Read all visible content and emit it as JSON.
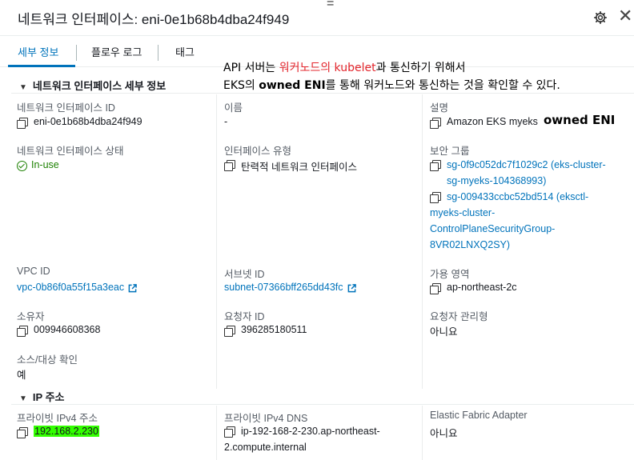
{
  "header": {
    "title": "네트워크 인터페이스: eni-0e1b68b4dba24f949",
    "drag_handle": "=",
    "close_symbol": "✕"
  },
  "tabs": [
    "세부 정보",
    "플로우 로그",
    "태그"
  ],
  "annotation": {
    "line1_a": "API 서버는 ",
    "line1_red": "워커노드의 kubelet",
    "line1_b": "과 통신하기 위해서",
    "line2_a": "EKS의 ",
    "line2_bold": "owned ENI",
    "line2_b": "를 통해 워커노드와 통신하는 것을 확인할 수 있다.",
    "side_note": "owned ENI"
  },
  "details_section": {
    "heading": "네트워크 인터페이스 세부 정보",
    "fields": {
      "eni_id_label": "네트워크 인터페이스 ID",
      "eni_id_value": "eni-0e1b68b4dba24f949",
      "name_label": "이름",
      "name_value": "-",
      "description_label": "설명",
      "description_value": "Amazon EKS myeks",
      "status_label": "네트워크 인터페이스 상태",
      "status_value": "In-use",
      "type_label": "인터페이스 유형",
      "type_value": "탄력적 네트워크 인터페이스",
      "sg_label": "보안 그룹",
      "sg1_line1": "sg-0f9c052dc7f1029c2 (eks-cluster-",
      "sg1_line2": "sg-myeks-104368993)",
      "sg2_line1": "sg-009433ccbc52bd514 (eksctl-",
      "sg2_line2": "myeks-cluster-",
      "sg2_line3": "ControlPlaneSecurityGroup-",
      "sg2_line4": "8VR02LNXQ2SY)",
      "vpc_label": "VPC ID",
      "vpc_value": "vpc-0b86f0a55f15a3eac",
      "subnet_label": "서브넷 ID",
      "subnet_value": "subnet-07366bff265dd43fc",
      "az_label": "가용 영역",
      "az_value": "ap-northeast-2c",
      "owner_label": "소유자",
      "owner_value": "009946608368",
      "requester_label": "요청자 ID",
      "requester_value": "396285180511",
      "requester_managed_label": "요청자 관리형",
      "requester_managed_value": "아니요",
      "src_dst_label": "소스/대상 확인",
      "src_dst_value": "예"
    }
  },
  "ip_section": {
    "heading": "IP 주소",
    "private_ipv4_label": "프라이빗 IPv4 주소",
    "private_ipv4_value": "192.168.2.230",
    "private_dns_label": "프라이빗 IPv4 DNS",
    "private_dns_line1": "ip-192-168-2-230.ap-northeast-",
    "private_dns_line2": "2.compute.internal",
    "efa_label": "Elastic Fabric Adapter",
    "efa_value": "아니요"
  },
  "colors": {
    "link": "#0073bb",
    "status_green": "#1d8102",
    "highlight": "#33ff00",
    "annotation_red": "#e3242b"
  },
  "icons": [
    "gear-icon",
    "close-icon",
    "copy-icon",
    "external-link-icon",
    "check-circle-icon",
    "caret-down-icon"
  ]
}
